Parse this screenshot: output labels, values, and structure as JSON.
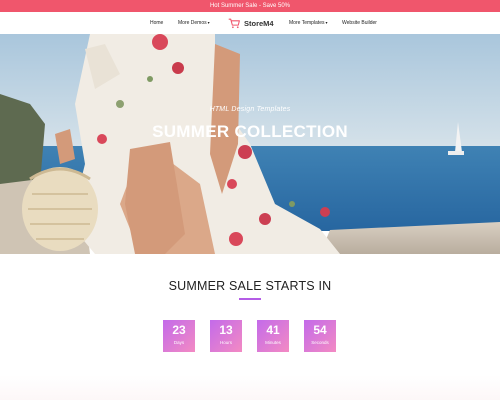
{
  "promo": {
    "text": "Hot Summer Sale - Save 50%"
  },
  "nav": {
    "home": "Home",
    "more_demos": "More Demos",
    "logo_text": "StoreM4",
    "more_templates": "More Templates",
    "website_builder": "Website Builder"
  },
  "hero": {
    "subtitle": "HTML Design Templates",
    "title": "SUMMER COLLECTION"
  },
  "sale": {
    "title": "SUMMER SALE STARTS IN",
    "countdown": [
      {
        "value": "23",
        "label": "Days"
      },
      {
        "value": "13",
        "label": "Hours"
      },
      {
        "value": "41",
        "label": "Minutes"
      },
      {
        "value": "54",
        "label": "Seconds"
      }
    ]
  },
  "colors": {
    "promo_bg": "#f0566c",
    "accent": "#b45ce6",
    "countdown_gradient_start": "#c36aea",
    "countdown_gradient_end": "#f38ac3"
  },
  "icons": {
    "logo": "shopping-cart-icon",
    "dropdown": "caret-down-icon"
  }
}
